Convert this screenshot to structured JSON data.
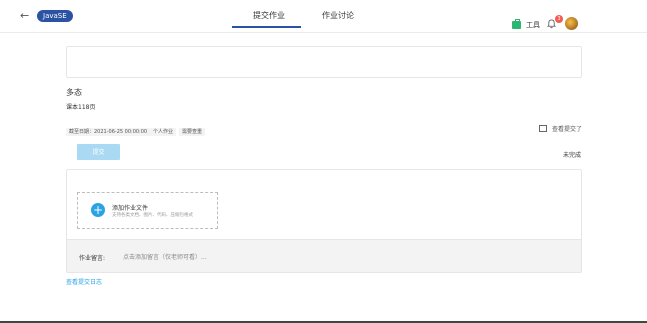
{
  "header": {
    "back_glyph": "←",
    "course_badge": "JavaSE",
    "tabs": [
      {
        "label": "提交作业",
        "active": true
      },
      {
        "label": "作业讨论",
        "active": false
      }
    ],
    "tools_label": "工具",
    "notification_count": "3",
    "accent_color": "#2b52a3"
  },
  "assignment": {
    "title": "多态",
    "subtitle": "课本118页",
    "meta": [
      "截至日期：2021-06-25 00:00:00",
      "个人作业",
      "需要查重"
    ],
    "view_submitted": "查看提交了",
    "submit_label": "提交",
    "status": "未完成"
  },
  "upload": {
    "add_icon": "+",
    "add_title": "添加作业文件",
    "add_hint": "支持各类文档、图片、代码、压缩包格式",
    "comment_label": "作业留言:",
    "comment_placeholder": "点击添加留言（仅老师可看）..."
  },
  "footer": {
    "log_link": "查看提交日志"
  }
}
